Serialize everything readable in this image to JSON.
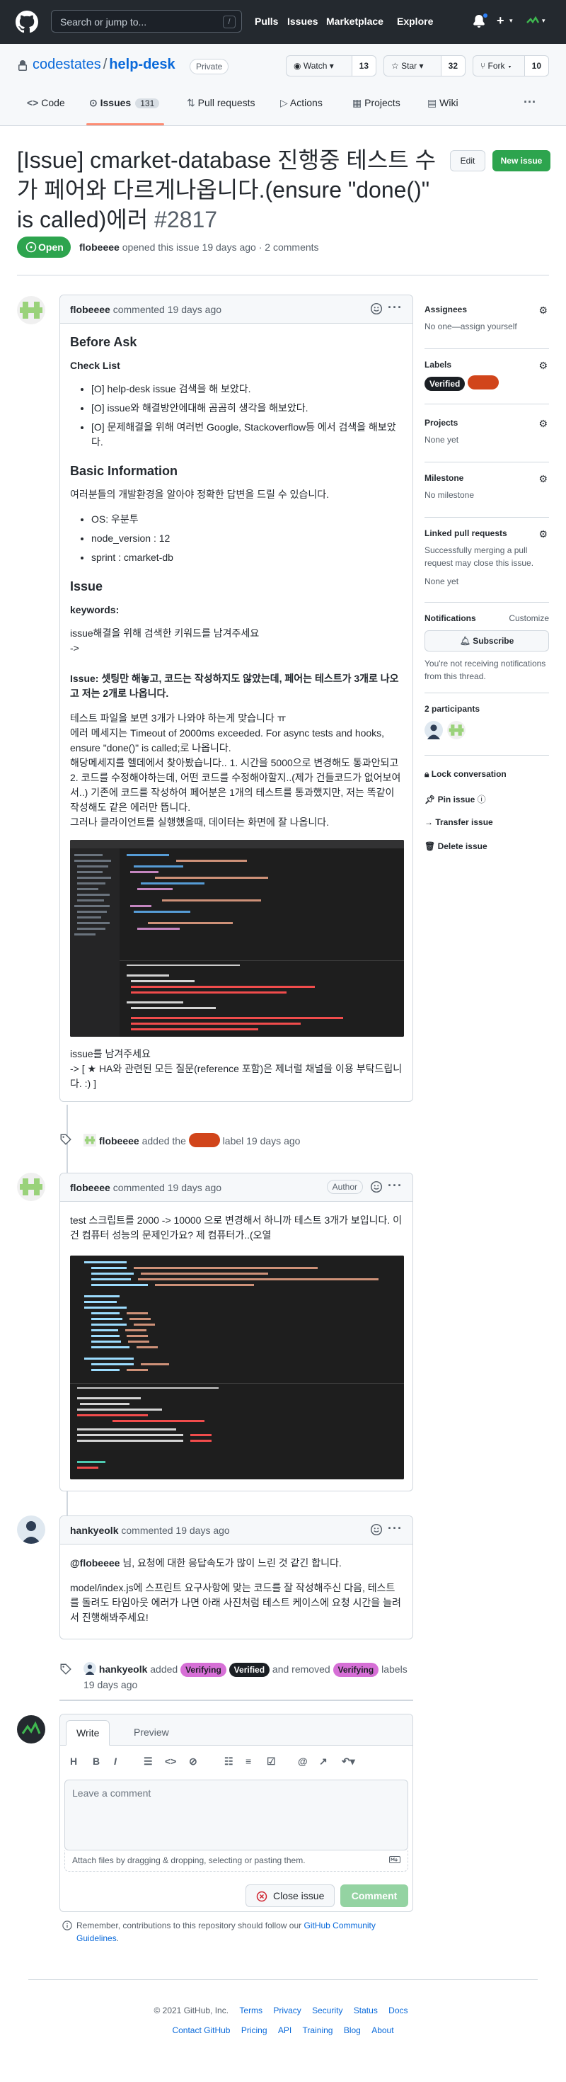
{
  "topbar": {
    "search_placeholder": "Search or jump to...",
    "search_kbd": "/",
    "nav": [
      "Pulls",
      "Issues",
      "Marketplace",
      "Explore"
    ]
  },
  "repo": {
    "owner": "codestates",
    "name": "help-desk",
    "visibility": "Private",
    "watch_label": "Watch",
    "watch_count": "13",
    "star_label": "Star",
    "star_count": "32",
    "fork_label": "Fork",
    "fork_count": "10"
  },
  "tabs": {
    "code": "Code",
    "issues": "Issues",
    "issues_count": "131",
    "pulls": "Pull requests",
    "actions": "Actions",
    "projects": "Projects",
    "wiki": "Wiki"
  },
  "issue": {
    "title": "[Issue] cmarket-database 진행중 테스트 수가 페어와 다르게나옵니다.(ensure \"done()\" is called)에러",
    "number": "#2817",
    "edit_label": "Edit",
    "new_issue_label": "New issue",
    "state": "Open",
    "author": "flobeeee",
    "meta_text": "opened this issue 19 days ago · 2 comments"
  },
  "comment1": {
    "author": "flobeeee",
    "time": "commented 19 days ago",
    "before_ask": "Before Ask",
    "checklist_title": "Check List",
    "checklist": [
      "[O] help-desk issue 검색을 해 보았다.",
      "[O] issue와 해결방안에대해 곰곰히 생각을 해보았다.",
      "[O] 문제해결을 위해 여러번 Google, Stackoverflow등 에서 검색을 해보았다."
    ],
    "basic_title": "Basic Information",
    "basic_intro": "여러분들의 개발환경을 알아야 정확한 답변을 드릴 수 있습니다.",
    "basic_items": [
      "OS: 우분투",
      "node_version : 12",
      "sprint : cmarket-db"
    ],
    "issue_heading": "Issue",
    "keywords_label": "keywords:",
    "keywords_text": "issue해결을 위해 검색한 키워드를 남겨주세요",
    "arrow": "->",
    "issue_bold": "Issue: 셋팅만 해놓고, 코드는 작성하지도 않았는데, 페어는 테스트가 3개로 나오고 저는 2개로 나옵니다.",
    "issue_p1": "테스트 파일을 보면 3개가 나와야 하는게 맞습니다 ㅠ",
    "issue_p2": "에러 메세지는 Timeout of 2000ms exceeded. For async tests and hooks, ensure \"done()\" is called;로 나옵니다.",
    "issue_p3": "해당메세지를 헬데에서 찾아봤습니다.. 1. 시간을 5000으로 변경해도 통과안되고 2. 코드를 수정해야하는데, 어떤 코드를 수정해야할지..(제가 건들코드가 없어보여서..) 기존에 코드를 작성하여 페어분은 1개의 테스트를 통과했지만, 저는 똑같이 작성해도 같은 에러만 뜹니다.",
    "issue_p4": "그러나 클라이언트를 실행했을때, 데이터는 화면에 잘 나옵니다.",
    "closing1": "issue를 남겨주세요",
    "closing2": "-> [ ★ HA와 관련된 모든 질문(reference 포함)은 제너럴 채널을 이용 부탁드립니다. :) ]"
  },
  "event1": {
    "actor": "flobeeee",
    "text_pre": "added the",
    "text_post": "label 19 days ago"
  },
  "comment2": {
    "author": "flobeeee",
    "time": "commented 19 days ago",
    "badge": "Author",
    "body": "test 스크립트를 2000 -> 10000 으로 변경해서 하니까 테스트 3개가 보입니다. 이건 컴퓨터 성능의 문제인가요? 제 컴퓨터가..(오열"
  },
  "comment3": {
    "author": "hankyeolk",
    "time": "commented 19 days ago",
    "mention": "@flobeeee",
    "line1": "님, 요청에 대한 응답속도가 많이 느린 것 같긴 합니다.",
    "line2": "model/index.js에 스프린트 요구사항에 맞는 코드를 잘 작성해주신 다음, 테스트를 돌려도 타임아웃 에러가 나면 아래 사진처럼 테스트 케이스에 요청 시간을 늘려서 진행해봐주세요!"
  },
  "event2": {
    "actor": "hankyeolk",
    "added": "added",
    "label_verifying": "Verifying",
    "label_verified": "Verified",
    "removed": "and removed",
    "label_verifying2": "Verifying",
    "labels_word": "labels",
    "time": "19 days ago"
  },
  "editor": {
    "tab_write": "Write",
    "tab_preview": "Preview",
    "placeholder": "Leave a comment",
    "attach_text": "Attach files by dragging & dropping, selecting or pasting them.",
    "close_label": "Close issue",
    "comment_label": "Comment"
  },
  "remember": {
    "text": "Remember, contributions to this repository should follow our",
    "link": "GitHub Community Guidelines",
    "end": "."
  },
  "sidebar": {
    "assignees_title": "Assignees",
    "assignees_text": "No one—assign yourself",
    "labels_title": "Labels",
    "label_verified": "Verified",
    "projects_title": "Projects",
    "projects_text": "None yet",
    "milestone_title": "Milestone",
    "milestone_text": "No milestone",
    "linked_title": "Linked pull requests",
    "linked_text": "Successfully merging a pull request may close this issue.",
    "linked_none": "None yet",
    "notifications_title": "Notifications",
    "customize": "Customize",
    "subscribe": "Subscribe",
    "notif_text": "You're not receiving notifications from this thread.",
    "participants": "2 participants",
    "lock": "Lock conversation",
    "pin": "Pin issue",
    "transfer": "Transfer issue",
    "delete": "Delete issue"
  },
  "footer": {
    "copyright": "© 2021 GitHub, Inc.",
    "row1": [
      "Terms",
      "Privacy",
      "Security",
      "Status",
      "Docs"
    ],
    "row2": [
      "Contact GitHub",
      "Pricing",
      "API",
      "Training",
      "Blog",
      "About"
    ]
  },
  "colors": {
    "accent": "#0969da",
    "open_green": "#2da44e",
    "label_bug": "#d1451b",
    "label_verifying": "#d66fd6",
    "label_verified": "#1b1f24"
  }
}
